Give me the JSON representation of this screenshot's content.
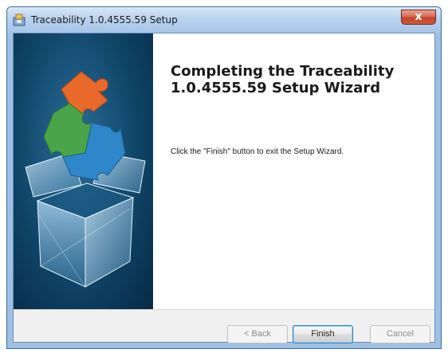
{
  "window": {
    "title": "Traceability 1.0.4555.59 Setup",
    "close_label": "x",
    "app_icon": "installer-icon"
  },
  "side_panel": {
    "graphic": "puzzle-box-graphic"
  },
  "content": {
    "heading": "Completing the Traceability 1.0.4555.59 Setup Wizard",
    "body": "Click the \"Finish\" button to exit the Setup Wizard."
  },
  "buttons": {
    "back": "< Back",
    "finish": "Finish",
    "cancel": "Cancel"
  },
  "colors": {
    "panel_dark": "#0f4568",
    "puzzle_orange": "#e8692a",
    "puzzle_green": "#4aa54a",
    "puzzle_blue": "#2f86c8"
  }
}
